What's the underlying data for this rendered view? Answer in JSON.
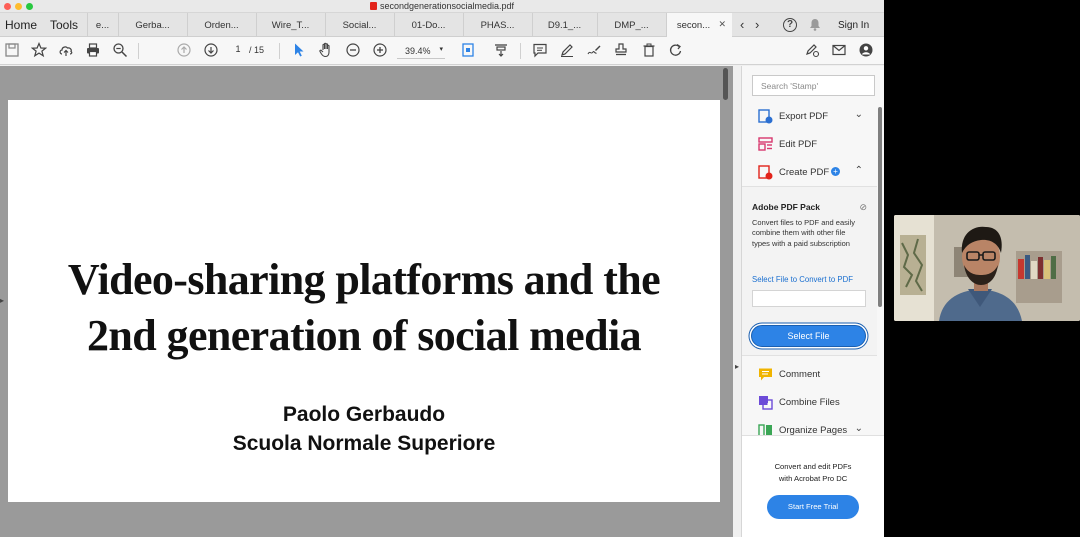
{
  "window": {
    "title": "secondgenerationsocialmedia.pdf"
  },
  "menu": {
    "home": "Home",
    "tools": "Tools"
  },
  "tabs": [
    {
      "label": "e..."
    },
    {
      "label": "Gerba..."
    },
    {
      "label": "Orden..."
    },
    {
      "label": "Wire_T..."
    },
    {
      "label": "Social..."
    },
    {
      "label": "01-Do..."
    },
    {
      "label": "PHAS..."
    },
    {
      "label": "D9.1_..."
    },
    {
      "label": "DMP_..."
    },
    {
      "label": "secon...",
      "active": true
    }
  ],
  "header_right": {
    "sign_in": "Sign In"
  },
  "toolbar": {
    "page_current": "1",
    "page_total": "/ 15",
    "zoom": "39.4%"
  },
  "document": {
    "title_line1": "Video-sharing platforms and the",
    "title_line2": "2nd generation of social media",
    "author": "Paolo Gerbaudo",
    "affiliation": "Scuola Normale Superiore"
  },
  "right_panel": {
    "search_placeholder": "Search 'Stamp'",
    "tools": {
      "export_pdf": "Export PDF",
      "edit_pdf": "Edit PDF",
      "create_pdf": "Create PDF",
      "comment": "Comment",
      "combine_files": "Combine Files",
      "organize_pages": "Organize Pages"
    },
    "pack": {
      "title": "Adobe PDF Pack",
      "description": "Convert files to PDF and easily combine them with other file types with a paid subscription",
      "link": "Select File to Convert to PDF",
      "select_button": "Select File"
    },
    "promo": {
      "line1": "Convert and edit PDFs",
      "line2": "with Acrobat Pro DC",
      "button": "Start Free Trial"
    }
  },
  "colors": {
    "accent": "#2d83e6",
    "export": "#2b6fd1",
    "edit": "#d8386e",
    "create": "#e2231a",
    "comment": "#f0b400",
    "combine": "#6c4bd8",
    "organize": "#3aa655"
  }
}
